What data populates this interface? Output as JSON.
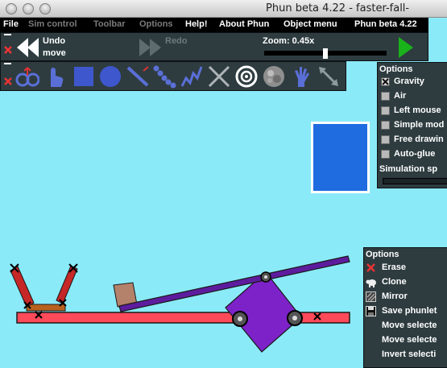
{
  "window": {
    "title": "Phun beta 4.22 - faster-fall-"
  },
  "menu": [
    "File",
    "Sim control",
    "Toolbar",
    "Options",
    "Help!",
    "About Phun",
    "Object menu",
    "Phun beta 4.22"
  ],
  "simbar": {
    "undo_label": "Undo move",
    "redo_label": "Redo",
    "zoom_label": "Zoom: 0.45x",
    "zoom_level": 0.45
  },
  "toolbar": {
    "tools": [
      "drag",
      "grab",
      "box",
      "circle",
      "line",
      "chain",
      "spring",
      "cross",
      "target",
      "texture",
      "hand",
      "arrow"
    ],
    "active_tool": "target"
  },
  "options_top": {
    "title": "Options",
    "items": [
      {
        "label": "Gravity",
        "checked": true
      },
      {
        "label": "Air",
        "checked": false
      },
      {
        "label": "Left mouse",
        "checked": false
      },
      {
        "label": "Simple mod",
        "checked": false
      },
      {
        "label": "Free drawin",
        "checked": false
      },
      {
        "label": "Auto-glue",
        "checked": false
      }
    ],
    "sim_speed_label": "Simulation sp"
  },
  "options_bottom": {
    "title": "Options",
    "items": [
      "Erase",
      "Clone",
      "Mirror",
      "Save phunlet",
      "Move selecte",
      "Move selecte",
      "Invert selecti"
    ]
  },
  "colors": {
    "sky": "#8beaf8",
    "panel": "#2e3c40",
    "platform": "#ff4a5a",
    "lever": "#5d1c9e",
    "square": "#7d22c9",
    "blue_box": "#1f6be0",
    "crate": "#b4826a"
  }
}
